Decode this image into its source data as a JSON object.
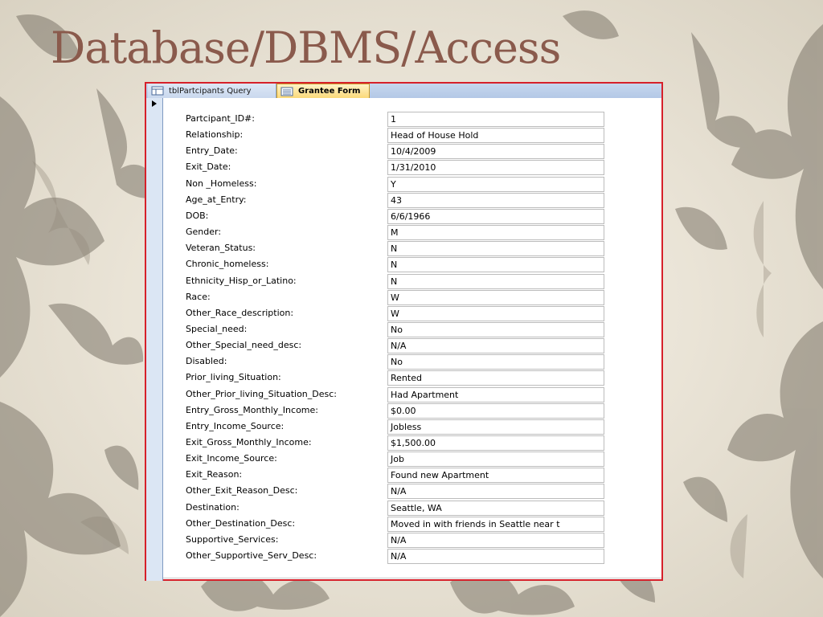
{
  "slide": {
    "title": "Database/DBMS/Access"
  },
  "tabs": [
    {
      "label": "tblPartcipants Query",
      "icon": "query-table-icon"
    },
    {
      "label": "Grantee Form",
      "icon": "form-icon",
      "active": true
    }
  ],
  "record_selector": {
    "icon": "current-record-arrow-icon"
  },
  "form": {
    "fields": [
      {
        "label": "Partcipant_ID#:",
        "value": "1"
      },
      {
        "label": "Relationship:",
        "value": "Head of House Hold"
      },
      {
        "label": "Entry_Date:",
        "value": "10/4/2009"
      },
      {
        "label": "Exit_Date:",
        "value": "1/31/2010"
      },
      {
        "label": "Non _Homeless:",
        "value": "Y"
      },
      {
        "label": "Age_at_Entry:",
        "value": "43"
      },
      {
        "label": "DOB:",
        "value": "6/6/1966"
      },
      {
        "label": "Gender:",
        "value": "M"
      },
      {
        "label": "Veteran_Status:",
        "value": "N"
      },
      {
        "label": "Chronic_homeless:",
        "value": "N"
      },
      {
        "label": "Ethnicity_Hisp_or_Latino:",
        "value": "N"
      },
      {
        "label": "Race:",
        "value": "W"
      },
      {
        "label": "Other_Race_description:",
        "value": "W"
      },
      {
        "label": "Special_need:",
        "value": "No"
      },
      {
        "label": "Other_Special_need_desc:",
        "value": "N/A"
      },
      {
        "label": "Disabled:",
        "value": "No"
      },
      {
        "label": "Prior_living_Situation:",
        "value": "Rented"
      },
      {
        "label": "Other_Prior_living_Situation_Desc:",
        "value": "Had Apartment"
      },
      {
        "label": "Entry_Gross_Monthly_Income:",
        "value": "$0.00"
      },
      {
        "label": "Entry_Income_Source:",
        "value": "Jobless"
      },
      {
        "label": "Exit_Gross_Monthly_Income:",
        "value": "$1,500.00"
      },
      {
        "label": "Exit_Income_Source:",
        "value": "Job"
      },
      {
        "label": "Exit_Reason:",
        "value": "Found new Apartment"
      },
      {
        "label": "Other_Exit_Reason_Desc:",
        "value": "N/A"
      },
      {
        "label": "Destination:",
        "value": "Seattle, WA"
      },
      {
        "label": "Other_Destination_Desc:",
        "value": "Moved in with friends in Seattle near t"
      },
      {
        "label": "Supportive_Services:",
        "value": "N/A"
      },
      {
        "label": "Other_Supportive_Serv_Desc:",
        "value": "N/A"
      }
    ]
  },
  "colors": {
    "title": "#8a5a4c",
    "screenshot_border": "#d6202a",
    "active_tab": "#fbd97a",
    "tab_bar": "#b3c8e6"
  }
}
